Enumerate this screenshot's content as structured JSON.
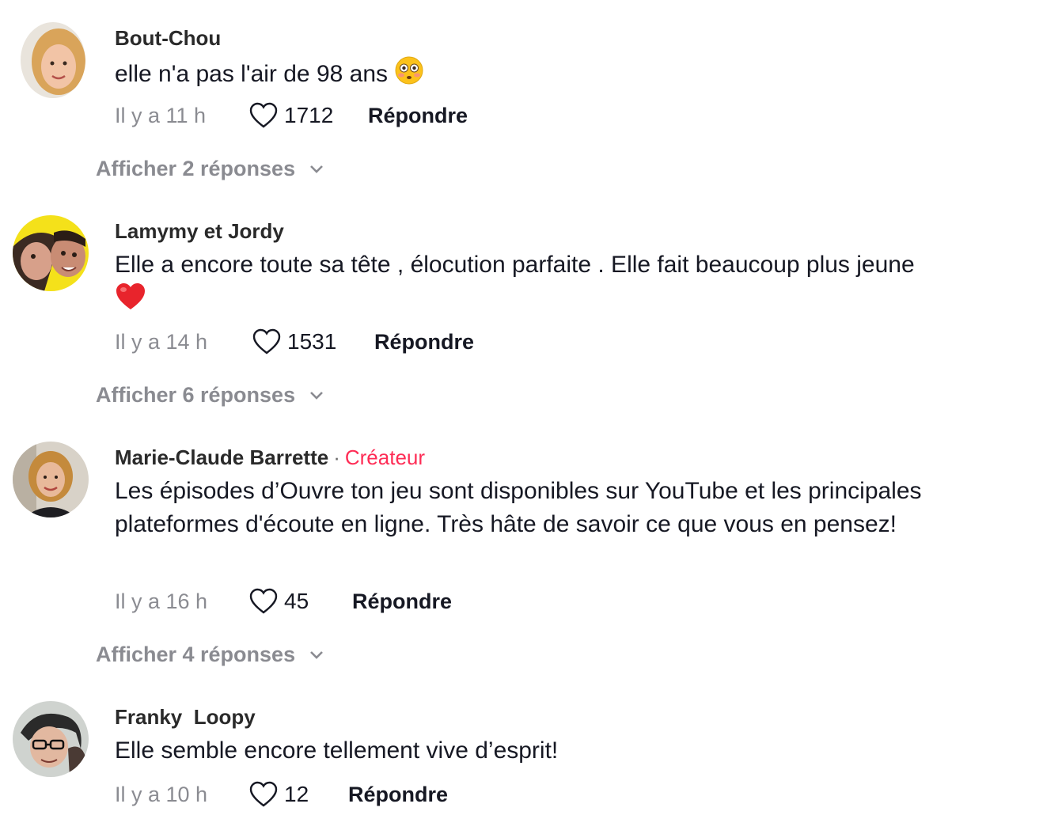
{
  "comments": [
    {
      "username": "Bout-Chou",
      "text": "elle n'a pas l'air de 98 ans",
      "emoji": "flushed-face",
      "time": "Il y a 11 h",
      "likes": "1712",
      "reply_label": "Répondre",
      "view_replies": "Afficher 2 réponses"
    },
    {
      "username": "Lamymy et Jordy",
      "text": "Elle a encore toute sa tête , élocution parfaite . Elle fait beaucoup plus jeune",
      "emoji": "red-heart",
      "time": "Il y a 14 h",
      "likes": "1531",
      "reply_label": "Répondre",
      "view_replies": "Afficher 6 réponses"
    },
    {
      "username": "Marie-Claude Barrette",
      "separator": "·",
      "badge": "Créateur",
      "text": "Les épisodes d’Ouvre ton jeu sont disponibles sur YouTube et les principales plateformes d'écoute en ligne. Très hâte de savoir ce que vous en pensez!",
      "time": "Il y a 16 h",
      "likes": "45",
      "reply_label": "Répondre",
      "view_replies": "Afficher 4 réponses"
    },
    {
      "username": "Franky  Loopy",
      "text": "Elle semble encore tellement vive d’esprit!",
      "time": "Il y a 10 h",
      "likes": "12",
      "reply_label": "Répondre"
    }
  ],
  "colors": {
    "creator_badge": "#fe2c55",
    "muted_text": "#8a8b91",
    "primary_text": "#161823"
  },
  "icons": [
    "heart-outline-icon",
    "chevron-down-icon",
    "flushed-face-emoji",
    "red-heart-emoji"
  ]
}
